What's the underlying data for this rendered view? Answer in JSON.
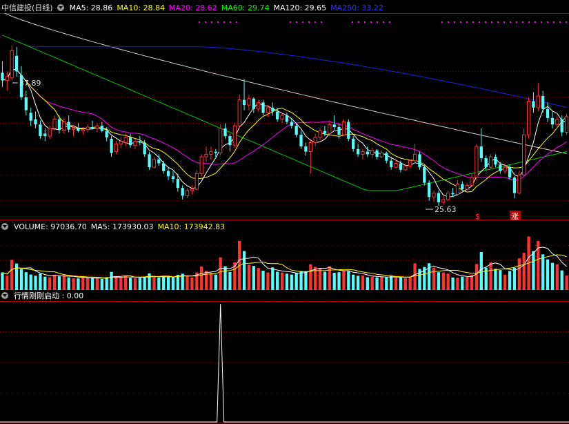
{
  "price_panel": {
    "stock_title": "中信建投(日线)",
    "indicators": [
      {
        "label": "MA5: 28.86",
        "color": "#ffffff"
      },
      {
        "label": "MA10: 28.84",
        "color": "#ffff00"
      },
      {
        "label": "MA20: 28.62",
        "color": "#ff00ff"
      },
      {
        "label": "MA60: 29.74",
        "color": "#00ff00"
      },
      {
        "label": "MA120: 29.65",
        "color": "#ffffff"
      },
      {
        "label": "MA250: 33.22",
        "color": "#3333ff"
      }
    ],
    "high_label": "37.89",
    "low_label": "25.63",
    "marker_s": "$",
    "marker_zhang": "涨"
  },
  "volume_panel": {
    "label": "VOLUME: 97036.70",
    "ma5": "MA5: 173930.03",
    "ma10": "MA10: 173942.83",
    "colors": {
      "label": "#ffffff",
      "ma5": "#ffffff",
      "ma10": "#ffff00"
    }
  },
  "signal_panel": {
    "label": "行情刚刚启动 : 0.00"
  },
  "colors": {
    "up": "#ff3232",
    "down": "#54ffff",
    "grid": "#8b0000",
    "border": "#b00000",
    "ma5": "#ffffff",
    "ma10": "#ffff00",
    "ma20": "#ff00ff",
    "ma60": "#00cc00",
    "ma120": "#d0d0d0",
    "ma250": "#2020e0",
    "dots": "#ff00ff"
  },
  "chart_data": {
    "type": "candlestick",
    "price_range": [
      24.5,
      40.5
    ],
    "candles": [
      [
        35.9,
        36.8,
        34.8,
        35.3
      ],
      [
        35.3,
        36.0,
        34.5,
        35.6
      ],
      [
        35.5,
        38.0,
        35.3,
        37.6
      ],
      [
        37.2,
        37.89,
        35.6,
        36.0
      ],
      [
        35.7,
        36.4,
        33.8,
        34.0
      ],
      [
        34.0,
        34.5,
        32.6,
        33.0
      ],
      [
        32.8,
        33.2,
        31.8,
        32.2
      ],
      [
        32.3,
        32.9,
        31.6,
        31.9
      ],
      [
        31.9,
        32.2,
        30.8,
        31.0
      ],
      [
        31.2,
        31.6,
        30.6,
        31.0
      ],
      [
        31.0,
        31.8,
        30.8,
        31.6
      ],
      [
        31.6,
        32.6,
        31.4,
        32.3
      ],
      [
        32.3,
        32.6,
        31.2,
        31.5
      ],
      [
        31.4,
        32.4,
        31.2,
        32.1
      ],
      [
        32.1,
        32.6,
        31.3,
        31.5
      ],
      [
        31.5,
        31.8,
        31.0,
        31.6
      ],
      [
        31.6,
        32.0,
        31.3,
        31.4
      ],
      [
        31.4,
        31.7,
        31.1,
        31.5
      ],
      [
        31.5,
        31.9,
        31.3,
        31.7
      ],
      [
        31.7,
        32.2,
        31.5,
        31.6
      ],
      [
        31.6,
        32.0,
        31.3,
        31.8
      ],
      [
        31.8,
        32.1,
        31.3,
        31.4
      ],
      [
        31.4,
        31.7,
        30.6,
        30.9
      ],
      [
        30.8,
        31.0,
        29.4,
        29.7
      ],
      [
        29.8,
        30.6,
        29.6,
        30.4
      ],
      [
        30.4,
        30.9,
        30.1,
        30.6
      ],
      [
        30.5,
        31.2,
        30.2,
        30.9
      ],
      [
        30.9,
        31.2,
        30.1,
        30.3
      ],
      [
        30.3,
        30.8,
        30.0,
        30.6
      ],
      [
        30.6,
        31.0,
        30.3,
        30.5
      ],
      [
        30.5,
        30.7,
        29.4,
        29.6
      ],
      [
        29.6,
        29.8,
        28.4,
        28.6
      ],
      [
        28.6,
        29.4,
        28.5,
        29.2
      ],
      [
        29.2,
        29.6,
        28.7,
        28.9
      ],
      [
        28.9,
        29.1,
        28.1,
        28.3
      ],
      [
        28.3,
        28.6,
        27.6,
        27.9
      ],
      [
        27.9,
        28.3,
        27.4,
        27.7
      ],
      [
        27.7,
        28.1,
        26.7,
        27.0
      ],
      [
        27.0,
        27.2,
        26.1,
        26.4
      ],
      [
        26.4,
        27.0,
        26.2,
        26.8
      ],
      [
        26.8,
        27.2,
        26.5,
        26.9
      ],
      [
        26.9,
        28.4,
        26.8,
        28.1
      ],
      [
        28.1,
        29.6,
        27.9,
        29.4
      ],
      [
        29.4,
        30.2,
        29.0,
        29.6
      ],
      [
        29.6,
        30.2,
        29.2,
        29.8
      ],
      [
        29.8,
        30.0,
        29.4,
        29.7
      ],
      [
        29.7,
        31.9,
        29.5,
        31.6
      ],
      [
        31.6,
        32.0,
        30.8,
        31.0
      ],
      [
        31.0,
        31.2,
        29.8,
        30.3
      ],
      [
        30.3,
        32.0,
        30.1,
        31.8
      ],
      [
        31.8,
        34.2,
        31.6,
        33.8
      ],
      [
        33.8,
        35.4,
        33.0,
        33.4
      ],
      [
        33.4,
        34.2,
        33.0,
        33.9
      ],
      [
        33.9,
        34.0,
        32.8,
        33.1
      ],
      [
        33.1,
        33.8,
        32.9,
        33.6
      ],
      [
        33.6,
        33.8,
        32.6,
        32.8
      ],
      [
        32.8,
        33.4,
        32.5,
        33.2
      ],
      [
        33.2,
        33.6,
        32.6,
        32.9
      ],
      [
        32.9,
        33.2,
        32.1,
        32.3
      ],
      [
        32.3,
        32.8,
        32.0,
        32.6
      ],
      [
        32.6,
        32.8,
        31.9,
        32.1
      ],
      [
        32.1,
        32.4,
        31.6,
        31.8
      ],
      [
        31.8,
        32.0,
        30.9,
        31.1
      ],
      [
        31.1,
        31.4,
        30.0,
        30.2
      ],
      [
        30.2,
        30.5,
        29.5,
        29.8
      ],
      [
        29.8,
        30.8,
        28.1,
        30.5
      ],
      [
        30.5,
        31.2,
        30.2,
        30.9
      ],
      [
        30.9,
        31.6,
        30.7,
        31.4
      ],
      [
        31.4,
        31.8,
        31.0,
        31.2
      ],
      [
        31.2,
        32.2,
        31.0,
        31.9
      ],
      [
        31.9,
        32.6,
        31.5,
        31.7
      ],
      [
        31.7,
        32.0,
        30.8,
        31.1
      ],
      [
        31.1,
        32.3,
        31.0,
        32.1
      ],
      [
        32.1,
        32.3,
        30.6,
        30.8
      ],
      [
        30.8,
        31.0,
        29.8,
        30.0
      ],
      [
        30.0,
        30.4,
        29.4,
        29.6
      ],
      [
        29.6,
        30.0,
        29.2,
        29.8
      ],
      [
        29.8,
        30.2,
        29.4,
        29.6
      ],
      [
        29.6,
        30.1,
        29.3,
        29.9
      ],
      [
        29.9,
        30.0,
        29.2,
        29.4
      ],
      [
        29.4,
        29.9,
        29.3,
        29.7
      ],
      [
        29.7,
        29.8,
        28.9,
        29.1
      ],
      [
        29.1,
        29.4,
        28.4,
        28.6
      ],
      [
        28.6,
        29.2,
        28.5,
        28.9
      ],
      [
        28.9,
        29.1,
        28.2,
        28.4
      ],
      [
        28.4,
        28.9,
        28.3,
        28.7
      ],
      [
        28.7,
        29.2,
        28.5,
        29.1
      ],
      [
        29.1,
        30.4,
        28.9,
        29.6
      ],
      [
        29.6,
        29.8,
        28.4,
        28.6
      ],
      [
        28.6,
        28.8,
        27.2,
        27.4
      ],
      [
        27.4,
        27.6,
        26.0,
        26.3
      ],
      [
        26.3,
        26.8,
        25.9,
        26.6
      ],
      [
        26.6,
        26.8,
        25.63,
        25.9
      ],
      [
        25.9,
        26.3,
        25.7,
        26.1
      ],
      [
        26.1,
        26.8,
        26.0,
        26.6
      ],
      [
        26.6,
        27.0,
        26.3,
        26.5
      ],
      [
        26.5,
        27.6,
        26.4,
        27.3
      ],
      [
        27.3,
        27.5,
        26.8,
        26.9
      ],
      [
        26.9,
        27.4,
        26.8,
        27.2
      ],
      [
        27.2,
        28.1,
        27.1,
        27.8
      ],
      [
        27.8,
        30.4,
        27.6,
        30.2
      ],
      [
        30.2,
        31.6,
        29.0,
        29.3
      ],
      [
        29.3,
        29.5,
        28.4,
        28.6
      ],
      [
        28.6,
        29.6,
        28.5,
        29.4
      ],
      [
        29.4,
        29.6,
        28.6,
        28.8
      ],
      [
        28.8,
        29.0,
        28.1,
        28.3
      ],
      [
        28.3,
        28.9,
        28.1,
        28.6
      ],
      [
        28.6,
        28.8,
        27.6,
        27.8
      ],
      [
        27.8,
        27.9,
        26.2,
        26.6
      ],
      [
        26.6,
        28.3,
        26.5,
        28.0
      ],
      [
        28.0,
        31.6,
        27.9,
        31.1
      ],
      [
        31.1,
        34.0,
        30.8,
        33.7
      ],
      [
        33.7,
        34.4,
        32.8,
        33.2
      ],
      [
        33.2,
        35.1,
        32.9,
        34.1
      ],
      [
        34.1,
        34.5,
        32.8,
        33.1
      ],
      [
        33.1,
        33.6,
        32.1,
        32.4
      ],
      [
        32.4,
        32.9,
        31.6,
        31.9
      ],
      [
        31.9,
        32.6,
        31.6,
        32.3
      ],
      [
        32.3,
        32.6,
        31.0,
        31.3
      ],
      [
        31.3,
        32.7,
        31.1,
        32.5
      ]
    ],
    "volume_range": [
      0,
      390000
    ],
    "volumes": [
      118000,
      96000,
      203000,
      178000,
      142000,
      120000,
      104000,
      96000,
      110000,
      90000,
      86000,
      103000,
      92000,
      99000,
      85000,
      80000,
      78000,
      84000,
      82000,
      80000,
      78000,
      75000,
      86000,
      122000,
      92000,
      83000,
      96000,
      82000,
      80000,
      81000,
      88000,
      112000,
      89000,
      84000,
      94000,
      88000,
      86000,
      102000,
      110000,
      92000,
      84000,
      118000,
      158000,
      130000,
      116000,
      104000,
      220000,
      160000,
      121000,
      186000,
      330000,
      262000,
      170000,
      162000,
      148000,
      130000,
      118000,
      152000,
      123000,
      118000,
      110000,
      104000,
      116000,
      128000,
      127000,
      173000,
      156000,
      148000,
      123000,
      160000,
      116000,
      120000,
      131000,
      126000,
      104000,
      96000,
      97000,
      86000,
      90000,
      85000,
      88000,
      84000,
      95000,
      82000,
      88000,
      80000,
      90000,
      180000,
      142000,
      155000,
      180000,
      150000,
      120000,
      118000,
      110000,
      84000,
      82000,
      90000,
      88000,
      104000,
      175000,
      255000,
      150000,
      186000,
      143000,
      134000,
      103000,
      128000,
      150000,
      213000,
      250000,
      360000,
      262000,
      330000,
      240000,
      206000,
      183000,
      173000,
      132000,
      97000
    ],
    "signal_range": [
      0,
      1
    ],
    "signal_spike_index": 46,
    "signal_value": 0.0,
    "x_axis": "trading days (daily)"
  }
}
